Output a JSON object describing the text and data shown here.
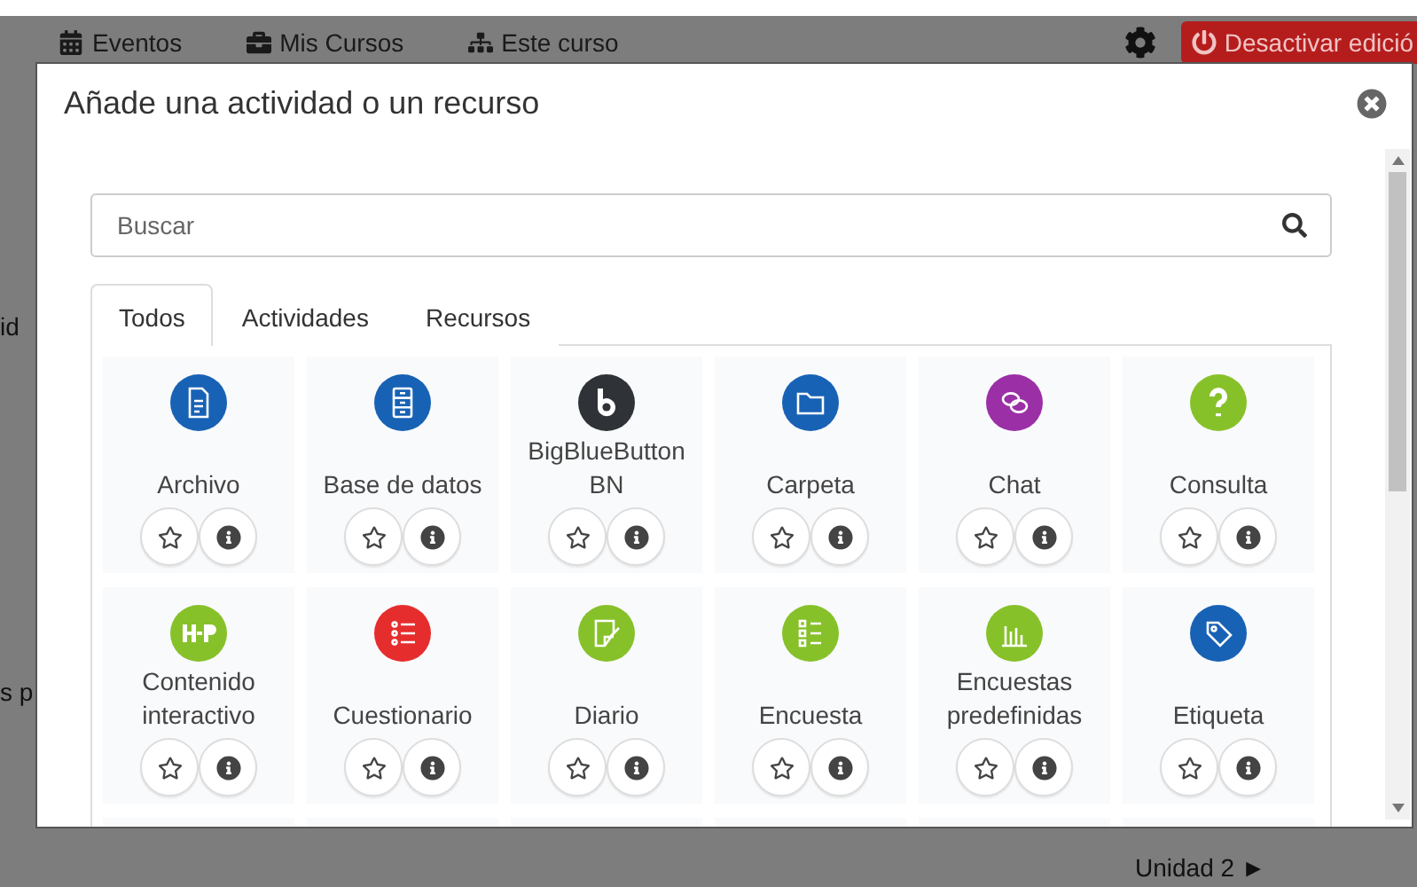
{
  "navbar": {
    "items": [
      {
        "label": "Eventos",
        "kind": "calendar"
      },
      {
        "label": "Mis Cursos",
        "kind": "briefcase"
      },
      {
        "label": "Este curso",
        "kind": "sitemap"
      }
    ],
    "edit_button": "Desactivar edició"
  },
  "background_fragments": [
    "id",
    "s p"
  ],
  "footer_link": "Unidad 2 ►",
  "modal": {
    "title": "Añade una actividad o un recurso",
    "search": {
      "placeholder": "Buscar"
    },
    "tabs": [
      {
        "label": "Todos",
        "selected": true
      },
      {
        "label": "Actividades",
        "selected": false
      },
      {
        "label": "Recursos",
        "selected": false
      }
    ],
    "items": [
      {
        "label": "Archivo",
        "kind": "file",
        "color": "#1862b5"
      },
      {
        "label": "Base de datos",
        "kind": "database",
        "color": "#1862b5"
      },
      {
        "label": "BigBlueButton BN",
        "kind": "bbb",
        "color": "#2f3337"
      },
      {
        "label": "Carpeta",
        "kind": "folder",
        "color": "#1862b5"
      },
      {
        "label": "Chat",
        "kind": "chat",
        "color": "#9b2fa6"
      },
      {
        "label": "Consulta",
        "kind": "question",
        "color": "#87c12a"
      },
      {
        "label": "Contenido interactivo",
        "kind": "h5p",
        "color": "#87c12a"
      },
      {
        "label": "Cuestionario",
        "kind": "list",
        "color": "#e62d2d"
      },
      {
        "label": "Diario",
        "kind": "note",
        "color": "#87c12a"
      },
      {
        "label": "Encuesta",
        "kind": "checklist",
        "color": "#87c12a"
      },
      {
        "label": "Encuestas predefinidas",
        "kind": "chart",
        "color": "#87c12a"
      },
      {
        "label": "Etiqueta",
        "kind": "tag",
        "color": "#1862b5"
      }
    ]
  }
}
